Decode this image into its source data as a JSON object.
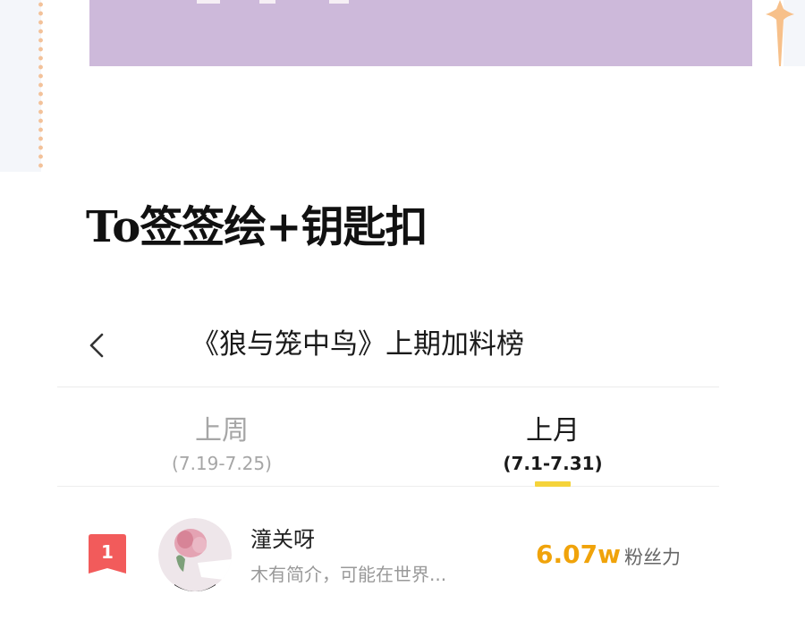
{
  "post": {
    "title": "To签签绘+钥匙扣"
  },
  "ranking": {
    "title": "《狼与笼中鸟》上期加料榜",
    "back_icon": "chevron-left-icon",
    "tabs": [
      {
        "label": "上周",
        "range": "(7.19-7.25)",
        "active": false
      },
      {
        "label": "上月",
        "range": "(7.1-7.31)",
        "active": true
      }
    ],
    "entries": [
      {
        "rank": "1",
        "name": "潼关呀",
        "bio": "木有简介，可能在世界...",
        "score": "6.07w",
        "score_unit": "粉丝力"
      }
    ]
  },
  "colors": {
    "banner": "#cdb9da",
    "accent_yellow": "#f5d33a",
    "score": "#f0a30a",
    "rank_badge": "#f25b5b"
  }
}
